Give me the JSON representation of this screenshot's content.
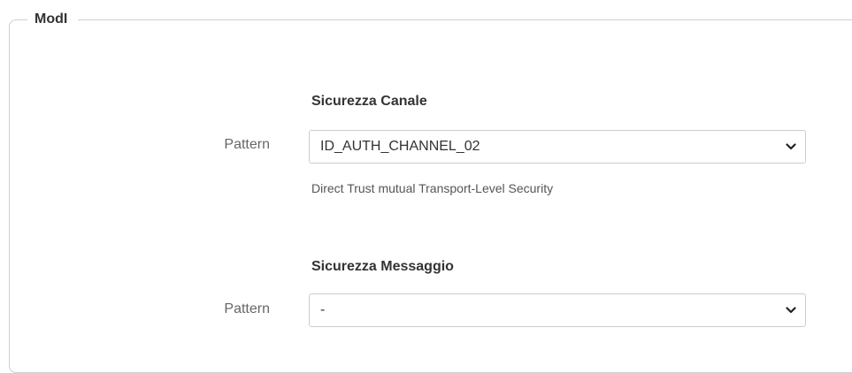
{
  "fieldset": {
    "legend": "ModI"
  },
  "channel_security": {
    "title": "Sicurezza Canale",
    "pattern_label": "Pattern",
    "pattern_value": "ID_AUTH_CHANNEL_02",
    "help": "Direct Trust mutual Transport-Level Security"
  },
  "message_security": {
    "title": "Sicurezza Messaggio",
    "pattern_label": "Pattern",
    "pattern_value": "-"
  },
  "icons": {
    "dropdown": "chevron-down-icon"
  }
}
